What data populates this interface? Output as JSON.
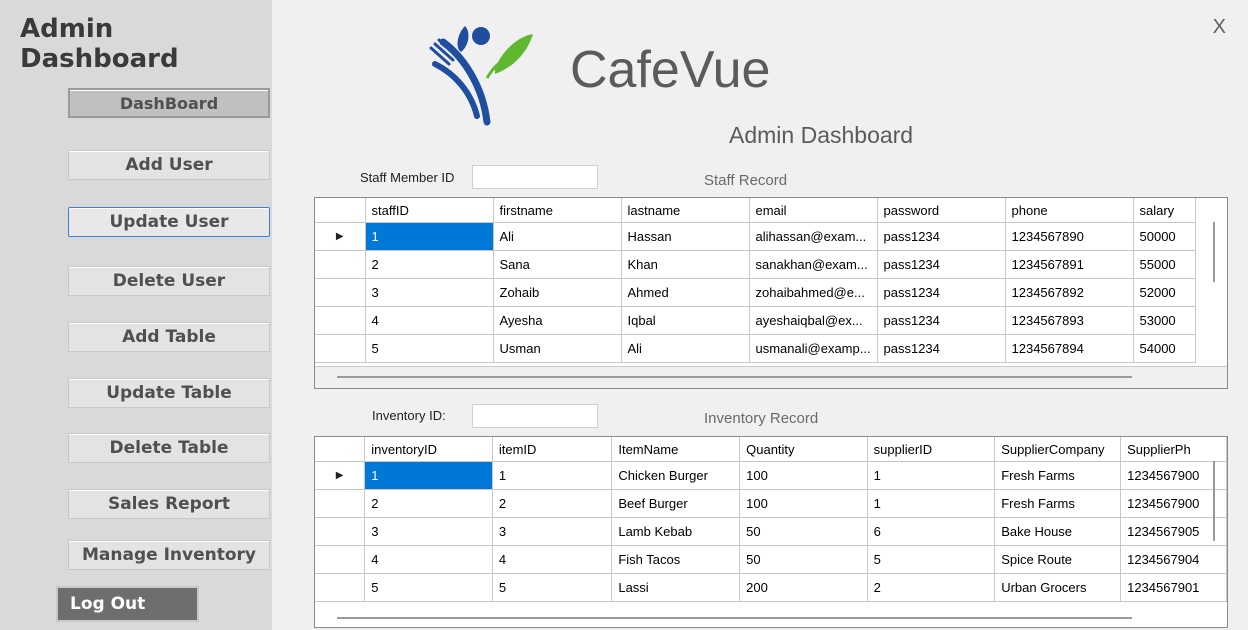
{
  "sidebar": {
    "title": "Admin Dashboard",
    "buttons": [
      {
        "label": "DashBoard"
      },
      {
        "label": "Add User"
      },
      {
        "label": "Update User"
      },
      {
        "label": "Delete User"
      },
      {
        "label": "Add Table"
      },
      {
        "label": "Update Table"
      },
      {
        "label": "Delete Table"
      },
      {
        "label": "Sales Report"
      },
      {
        "label": "Manage Inventory"
      }
    ],
    "logout_label": "Log Out"
  },
  "header": {
    "close_label": "X",
    "brand": "CafeVue",
    "subtitle": "Admin Dashboard"
  },
  "staff": {
    "id_label": "Staff Member ID",
    "id_value": "",
    "caption": "Staff Record",
    "columns": [
      "staffID",
      "firstname",
      "lastname",
      "email",
      "password",
      "phone",
      "salary"
    ],
    "rows": [
      [
        "1",
        "Ali",
        "Hassan",
        "alihassan@exam...",
        "pass1234",
        "1234567890",
        "50000"
      ],
      [
        "2",
        "Sana",
        "Khan",
        "sanakhan@exam...",
        "pass1234",
        "1234567891",
        "55000"
      ],
      [
        "3",
        "Zohaib",
        "Ahmed",
        "zohaibahmed@e...",
        "pass1234",
        "1234567892",
        "52000"
      ],
      [
        "4",
        "Ayesha",
        "Iqbal",
        "ayeshaiqbal@ex...",
        "pass1234",
        "1234567893",
        "53000"
      ],
      [
        "5",
        "Usman",
        "Ali",
        "usmanali@examp...",
        "pass1234",
        "1234567894",
        "54000"
      ]
    ],
    "current_row_marker": "▶"
  },
  "inventory": {
    "id_label": "Inventory ID:",
    "id_value": "",
    "caption": "Inventory Record",
    "columns": [
      "inventoryID",
      "itemID",
      "ItemName",
      "Quantity",
      "supplierID",
      "SupplierCompany",
      "SupplierPh"
    ],
    "rows": [
      [
        "1",
        "1",
        "Chicken Burger",
        "100",
        "1",
        "Fresh Farms",
        "1234567900"
      ],
      [
        "2",
        "2",
        "Beef Burger",
        "100",
        "1",
        "Fresh Farms",
        "1234567900"
      ],
      [
        "3",
        "3",
        "Lamb Kebab",
        "50",
        "6",
        "Bake House",
        "1234567905"
      ],
      [
        "4",
        "4",
        "Fish Tacos",
        "50",
        "5",
        "Spice Route",
        "1234567904"
      ],
      [
        "5",
        "5",
        "Lassi",
        "200",
        "2",
        "Urban Grocers",
        "1234567901"
      ]
    ],
    "current_row_marker": "▶"
  },
  "colors": {
    "selection": "#0078d7",
    "active_border": "#3c7fd6",
    "logo_blue": "#1f4e9e",
    "logo_green": "#5fb830"
  }
}
